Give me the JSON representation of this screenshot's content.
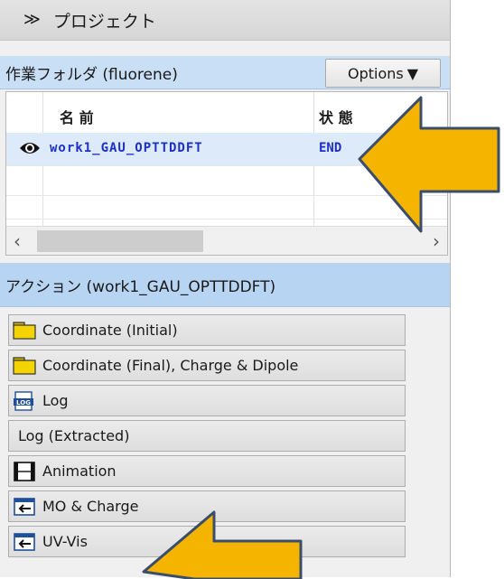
{
  "panel": {
    "title": "プロジェクト",
    "collapse_icon": "double-chevron-down-icon"
  },
  "work_folder": {
    "label": "作業フォルダ (fluorene)",
    "options_label": "Options",
    "options_icon": "triangle-down-icon",
    "columns": {
      "name": "名 前",
      "status": "状 態"
    },
    "rows": [
      {
        "icon": "eye-icon",
        "name": "work1_GAU_OPTTDDFT",
        "status": "END"
      }
    ]
  },
  "action": {
    "label": "アクション (work1_GAU_OPTTDDFT)",
    "buttons": [
      {
        "label": "Coordinate (Initial)",
        "icon": "folder-icon"
      },
      {
        "label": "Coordinate (Final), Charge & Dipole",
        "icon": "folder-icon"
      },
      {
        "label": "Log",
        "icon": "log-file-icon"
      },
      {
        "label": "Log (Extracted)",
        "icon": ""
      },
      {
        "label": "Animation",
        "icon": "film-icon"
      },
      {
        "label": "MO & Charge",
        "icon": "window-arrow-icon"
      },
      {
        "label": "UV-Vis",
        "icon": "window-arrow-icon"
      }
    ]
  },
  "colors": {
    "selection_bar": "#b7d4f2",
    "selected_text": "#1f2fc4",
    "arrow_fill": "#f5b400",
    "arrow_stroke": "#3a4e6b"
  }
}
